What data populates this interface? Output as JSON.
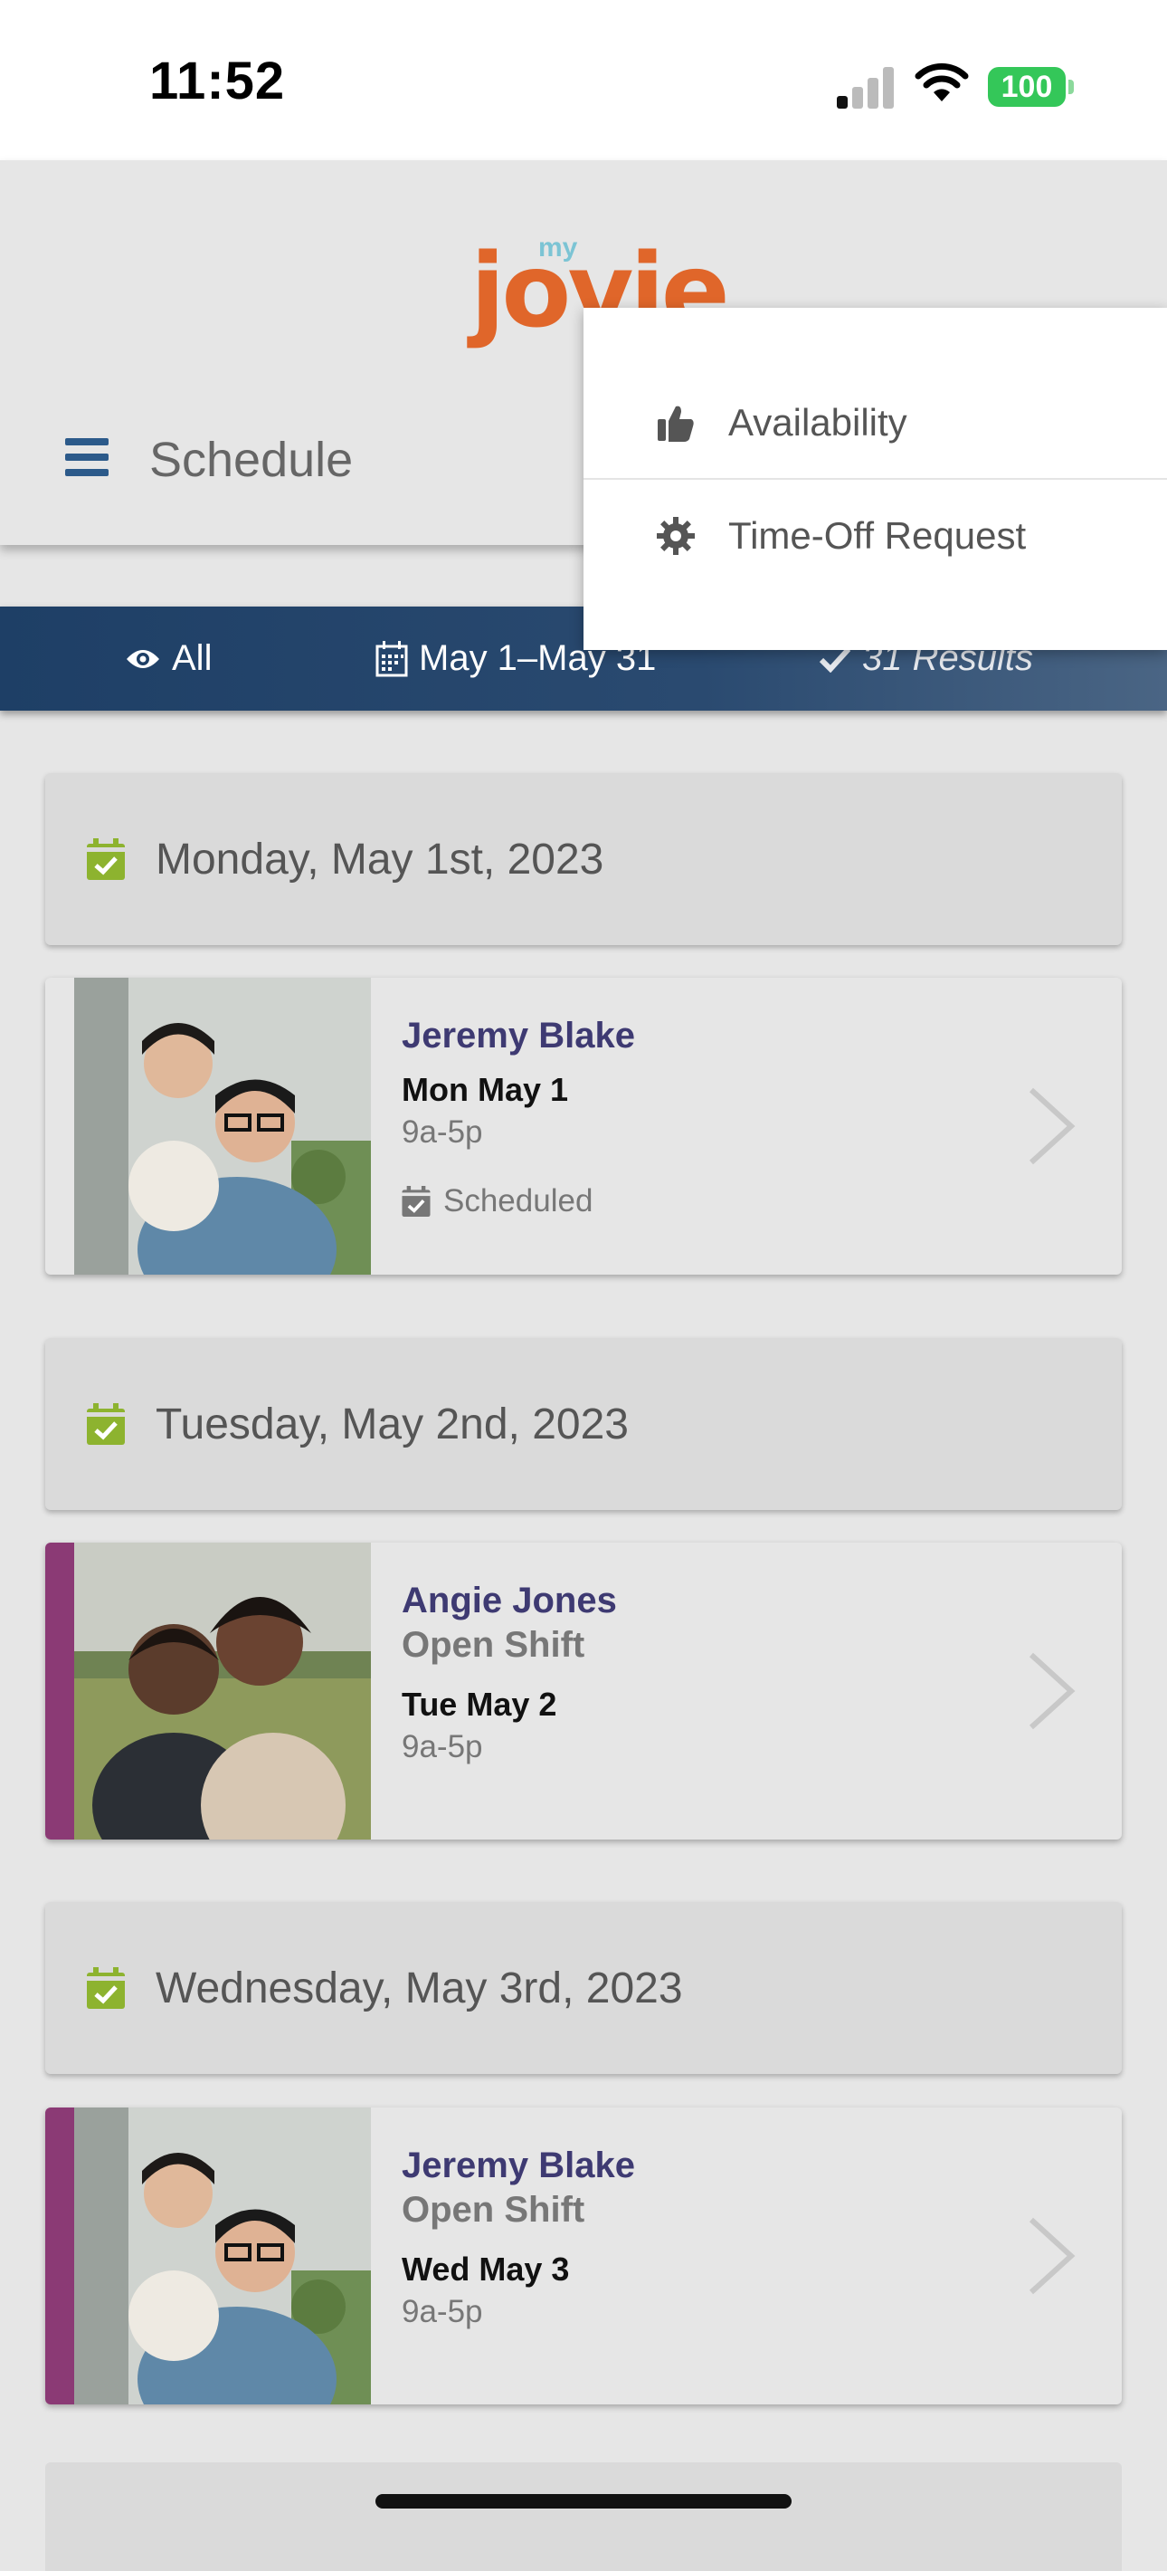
{
  "status_bar": {
    "time": "11:52",
    "battery": "100"
  },
  "header": {
    "logo_small": "my",
    "logo_main": "jovie",
    "title": "Schedule"
  },
  "filter_bar": {
    "all_label": "All",
    "date_range": "May 1–May 31",
    "results": "31 Results"
  },
  "menu": {
    "items": [
      {
        "label": "Availability",
        "icon": "thumbs-up-icon"
      },
      {
        "label": "Time-Off Request",
        "icon": "gear-icon"
      }
    ]
  },
  "days": [
    {
      "header": "Monday, May 1st, 2023",
      "card": {
        "name": "Jeremy Blake",
        "shift": "",
        "date": "Mon May 1",
        "hours": "9a-5p",
        "status": "Scheduled",
        "stripe": false
      }
    },
    {
      "header": "Tuesday, May 2nd, 2023",
      "card": {
        "name": "Angie Jones",
        "shift": "Open Shift",
        "date": "Tue May 2",
        "hours": "9a-5p",
        "status": "",
        "stripe": true
      }
    },
    {
      "header": "Wednesday, May 3rd, 2023",
      "card": {
        "name": "Jeremy Blake",
        "shift": "Open Shift",
        "date": "Wed May 3",
        "hours": "9a-5p",
        "status": "",
        "stripe": true
      }
    }
  ],
  "colors": {
    "accent_blue": "#1e3f66",
    "logo_orange": "#e0662a",
    "calendar_green": "#8db32f",
    "stripe_purple": "#8b3a75",
    "name_color": "#3e3a72"
  }
}
